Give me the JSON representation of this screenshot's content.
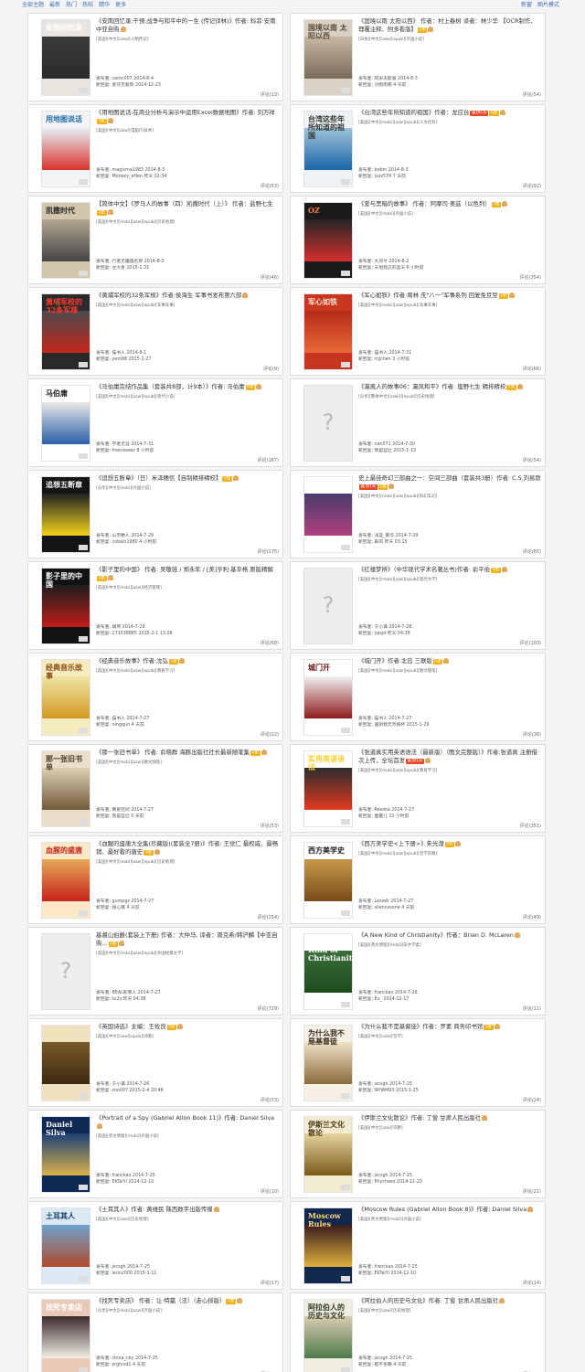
{
  "topbar": {
    "left": [
      "全部主题",
      "最新",
      "热门",
      "热帖",
      "精华",
      "更多"
    ],
    "right": [
      "新窗",
      "图片模式"
    ]
  },
  "posts": [
    {
      "title": "《安南回忆录:干预:战争与和平中的一生 (传记译林)》作者: 科菲·安南 中亚自购",
      "badges": [
        "thumb"
      ],
      "tags": "[美国][中文][azw][人物传记]",
      "poster": "发布者: caroc007 2014-8-4",
      "reply": "新回复: 墨仔无敌熊 2014-12-23",
      "comments": "评论(13)",
      "cover": {
        "bg": "#e9e6df",
        "mid": "#3a3a3a",
        "accent": "#2b2b2b",
        "text": "安南回忆录",
        "tc": "#ffffff"
      }
    },
    {
      "title": "《国境以南 太阳以西》 作者：村上春树 译者：林少华 【OCR制作、理覆注释、附多看版】",
      "badges": [
        "yellow:5星",
        "thumb"
      ],
      "tags": "[日本][中文][azw][epub][外国小说]",
      "poster": "发布者: 阿米夫斯基 2014-8-3",
      "reply": "新回复: 对街南嘟 4 天前",
      "comments": "评论(54)",
      "cover": {
        "bg": "#d8d1c4",
        "mid": "#c7b9a5",
        "accent": "#7a6a5a",
        "text": "国境以南 太阳以西",
        "tc": "#5b4c3d"
      }
    },
    {
      "title": "《用地图说话:在商业分析与演示中运用Excel数据地图》作者: 刘万祥",
      "badges": [
        "yellow:5星",
        "thumb"
      ],
      "tags": "[美国][中文][azw][电脑IT/技术]",
      "poster": "发布者: magicma1983 2014-8-3",
      "reply": "新回复: Monkey_eHen 昨天 02:34",
      "comments": "评论(63)",
      "cover": {
        "bg": "#f4f4f4",
        "mid": "#e7eef4",
        "accent": "#d9342b",
        "text": "用地图说话",
        "tc": "#1f6fb0"
      }
    },
    {
      "title": "《台湾这些年所知道的祖国》作者：龙应台",
      "badges": [
        "red:置顶1天",
        "yellow:5星",
        "thumb"
      ],
      "tags": "[美国][中文][mobi][azw][epub][人文社科]",
      "poster": "发布者: bobm 2014-8-3",
      "reply": "新回复: jxzx574 7 天前",
      "comments": "评论(92)",
      "cover": {
        "bg": "#eef2f4",
        "mid": "#9cc1d8",
        "accent": "#1b67a9",
        "text": "台湾这些年所知道的祖国",
        "tc": "#333333"
      }
    },
    {
      "title": "【简体中文】《罗马人的故事（四）凯撒时代（上）》 作者：盐野七生",
      "badges": [
        "yellow:5星",
        "thumb"
      ],
      "tags": "[美国][中文][mobi][azw][epub][历史地理]",
      "poster": "发布者: 行者无疆遇名即 2014-8-3",
      "reply": "新回复: 左大星 2015-1-31",
      "comments": "评论(46)",
      "pink": true,
      "cover": {
        "bg": "#d2c7ad",
        "mid": "#b3a78f",
        "accent": "#444444",
        "text": "凯撒时代",
        "tc": "#2c2c2c"
      }
    },
    {
      "title": "《爱与黑暗的故事》 作者：阿摩司·奥兹（以色列）",
      "badges": [
        "yellow:5星",
        "thumb"
      ],
      "tags": "[美国][中文][mobi][外国小说]",
      "poster": "发布者: 大风兮 2014-8-2",
      "reply": "新回复: 天地我辺的蓝天 6 小时前",
      "comments": "评论(354)",
      "cover": {
        "bg": "#1a1a1a",
        "mid": "#262626",
        "accent": "#d42e2e",
        "text": "OZ",
        "tc": "#ff7e4a"
      }
    },
    {
      "title": "《黄埔军校的32条军规》作者:侯海生 军事书发布第六部",
      "badges": [
        "thumb"
      ],
      "tags": "[美国][中文][mobi][azw][epub][军事军事]",
      "poster": "发布者: 猫书人 2014-8-1",
      "reply": "新回复: yem88 2015-1-27",
      "comments": "评论(9)",
      "cover": {
        "bg": "#2a2a2a",
        "mid": "#4a4a4a",
        "accent": "#c4261e",
        "text": "黄埔军校的32条军规",
        "tc": "#ff3b2e"
      }
    },
    {
      "title": "《军心如铁》作者:周林 庆\"八一\"军事系列 回复免豆豆",
      "badges": [
        "yellow:5星",
        "thumb"
      ],
      "tags": "[美国][中文][mobi][azw][epub][军事军事]",
      "poster": "发布者: 猫书人 2014-7-31",
      "reply": "新回复: rrjjchen 3 小时前",
      "comments": "评论(66)",
      "cover": {
        "bg": "#c8361f",
        "mid": "#b52a18",
        "accent": "#e86a3a",
        "text": "军心如铁",
        "tc": "#ffdfd0"
      }
    },
    {
      "title": "《马伯庸完结作品集（套装共8部，计9本）》作者: 马伯庸",
      "badges": [
        "yellow:5星",
        "thumb"
      ],
      "tags": "[美国][中文][mobi][azw][epub][现代小说]",
      "poster": "发布者: 学者无涯 2014-7-31",
      "reply": "新回复: freeviewer 8 小时前",
      "comments": "评论(167)",
      "cover": {
        "bg": "#ffffff",
        "mid": "#e8e8e8",
        "accent": "#2a5fa8",
        "text": "马伯庸",
        "tc": "#1f1f1f"
      }
    },
    {
      "title": "《瀛風人的故事06：瀛风和平》作者: 塩野七生 精排精校",
      "badges": [
        "yellow:5星",
        "thumb"
      ],
      "tags": "[分享][繁体中文][azw3][epub][历史地理]",
      "poster": "发布者: nan571 2014-7-30",
      "reply": "新回复: 我是蓝灶 2015-1-13",
      "comments": "评论(54)",
      "placeholder": true
    },
    {
      "title": "《追想五断章》（日）米泽穗信【自制精排精校】",
      "badges": [
        "yellow:5星",
        "thumb"
      ],
      "tags": "[分享][中文][mobi][外国小说]",
      "poster": "发布者: 山奈敷人 2014-7-29",
      "reply": "新回复: cobain1980 4 小时前",
      "comments": "评论(175)",
      "cover": {
        "bg": "#151515",
        "mid": "#222222",
        "accent": "#f2d21c",
        "text": "追想五断章",
        "tc": "#f2f2f2"
      }
    },
    {
      "title": "史上最佳奇幻三部曲之一：空间三部曲（套装共3册）作者: C.S.刘易斯",
      "badges": [
        "red:置顶1天",
        "yellow:5星",
        "thumb"
      ],
      "tags": "[美国][中文][mobi][azw][epub][科幻玄幻]",
      "poster": "发布者: 浅蓝_繁华 2014-7-29",
      "reply": "新回复: 辟凤 昨天 03:15",
      "comments": "评论(65)",
      "cover": {
        "bg": "#ffffff",
        "mid": "#4b3a6e",
        "accent": "#b0417a",
        "text": "空间三部曲",
        "tc": "#ffffff"
      }
    },
    {
      "title": "《影子里的中国》 作者: 吴敬琏 / 郑永年 / [美]亨利·基辛格 原版精解",
      "badges": [
        "yellow:5星",
        "thumb"
      ],
      "tags": "[美国][中文][mobi][azw][经济管理]",
      "poster": "发布者: 胡燕 2014-7-29",
      "reply": "新回复: 271538885 2015-2-1 13:06",
      "comments": "评论(68)",
      "cover": {
        "bg": "#121212",
        "mid": "#1d1d1d",
        "accent": "#c21d1d",
        "text": "影子里的中国",
        "tc": "#ffffff"
      }
    },
    {
      "title": "《红楼梦辨》（中华现代学术名著丛书)作者: 俞平伯",
      "badges": [
        "yellow:5星",
        "thumb"
      ],
      "tags": "[美国][中文][mobi][azw][epub][现代文学]",
      "poster": "发布者: 于小满 2014-7-28",
      "reply": "新回复: ypsjd 昨天 04:38",
      "comments": "评论(103)",
      "placeholder": true
    },
    {
      "title": "《经典音乐故事》作者:沈弘",
      "badges": [
        "yellow:5星",
        "thumb"
      ],
      "tags": "[美国][中文][mobi][azw][epub][教育学习]",
      "poster": "发布者: 猫书人 2014-7-27",
      "reply": "新回复: ningqun 4 天前",
      "comments": "评论(22)",
      "cover": {
        "bg": "#f4ecbf",
        "mid": "#efe3a5",
        "accent": "#d19a22",
        "text": "经典音乐故事",
        "tc": "#8a4a10"
      }
    },
    {
      "title": "《城门开》作者:北岛 三联版",
      "badges": [
        "yellow:5星",
        "thumb"
      ],
      "tags": "[美国][中文][mobi][azw][epub][散文随笔]",
      "poster": "发布者: 猫书人 2014-7-27",
      "reply": "新回复: 遇到我无奈摔杯 2015-1-29",
      "comments": "评论(36)",
      "cover": {
        "bg": "#ffffff",
        "mid": "#f0f0f0",
        "accent": "#8e1d1d",
        "text": "城门开",
        "tc": "#6e1414"
      }
    },
    {
      "title": "《那一张旧书单》 作者: 俞晓群 海豚出版社社长最新随笔集",
      "badges": [
        "yellow:5星",
        "thumb"
      ],
      "tags": "[美国][中文][mobi][azw][散文随笔]",
      "poster": "发布者: 黄葛空间 2014-7-27",
      "reply": "新回复: 我是蓝灶 5 天前",
      "comments": "评论(53)",
      "cover": {
        "bg": "#e9dfc8",
        "mid": "#ddd0b3",
        "accent": "#6f5a3a",
        "text": "那一张旧书单",
        "tc": "#4a3a26"
      }
    },
    {
      "title": "《张道真实用英语语法（最新版）（图文完整版）》作者:张道真 注册借次上传，全坛首发",
      "badges": [
        "red:置顶1天",
        "thumb"
      ],
      "tags": "[美国][中文][mobi][azw][epub][教育学习]",
      "poster": "发布者: Rexoka 2014-7-27",
      "reply": "新回复: 面蔓儿 11 小时前",
      "comments": "评论(351)",
      "cover": {
        "bg": "#ffffff",
        "mid": "#2c2c2c",
        "accent": "#e03a1e",
        "text": "实用英语语法",
        "tc": "#ffcf26"
      }
    },
    {
      "title": "《血腥的盛唐大全集(珍藏版)(套装全7册)》作者: 王觉仁 最权威、最畅销、最好看的唐史",
      "badges": [
        "yellow:5星",
        "thumb"
      ],
      "tags": "[美国][中文][mobi][azw][epub][历史地理]",
      "poster": "发布者: gumpgz 2014-7-27",
      "reply": "新回复: 接心鹰 4 天前",
      "comments": "评论(154)",
      "cover": {
        "bg": "#fbe8c6",
        "mid": "#e8a85a",
        "accent": "#c7241b",
        "text": "血腥的盛唐",
        "tc": "#c7241b"
      }
    },
    {
      "title": "《西方美学史<上下册>》朱光潜",
      "badges": [
        "yellow:5星",
        "thumb"
      ],
      "tags": "[美国][中文][mobi][azw][epub][哲学宗教]",
      "poster": "发布者: Leszek 2014-7-27",
      "reply": "新回复: silencesone 4 天前",
      "comments": "评论(49)",
      "cover": {
        "bg": "#ffffff",
        "mid": "#c79a4a",
        "accent": "#7a4a1a",
        "text": "西方美学史",
        "tc": "#222222"
      }
    },
    {
      "title": "基督山伯爵(套装上下册) 作者：大仲马, 译者：周克希/韩沪麟【中亚自购...",
      "badges": [
        "yellow:5星",
        "thumb"
      ],
      "tags": "[美国][中文][mobi][azw][epub][外国经典文学]",
      "poster": "发布者: BEAL斯莱人 2014-7-27",
      "reply": "新回复: tu2s 昨天 04:38",
      "comments": "评论(729)",
      "placeholder": true
    },
    {
      "title": "《A New Kind of Christianity》作者：Brian D. McLaren",
      "badges": [
        "thumb"
      ],
      "tags": "[美国][英文原版][mobi][非文学类]",
      "poster": "发布者: franckao 2014-7-26",
      "reply": "新回复: Eu_ 2014-12-17",
      "comments": "评论(11)",
      "cover": {
        "bg": "#ffffff",
        "mid": "#3a6f3a",
        "accent": "#1e4a1e",
        "text": "A New Kind of Christianity",
        "tc": "#ffffff"
      }
    },
    {
      "title": "《英国诗选》主编：王佐良",
      "badges": [
        "yellow:5星",
        "thumb"
      ],
      "tags": "[美国][中文][azw][epub][诗歌]",
      "poster": "发布者: 于小满 2014-7-26",
      "reply": "新回复: zoo007 2015-2-4 20:48",
      "comments": "评论(33)",
      "cover": {
        "bg": "#efe1c0",
        "mid": "#7a5a2a",
        "accent": "#3a2a12",
        "text": "英国诗选",
        "tc": "#f4e4b4"
      }
    },
    {
      "title": "《为什么我不是基督徒》作者：罗素 商务印书馆",
      "badges": [
        "yellow:5星",
        "thumb"
      ],
      "tags": "[美国][中文][azw][哲学]",
      "poster": "发布者: jscsgh 2014-7-25",
      "reply": "新回复: WHAM93 2015-1-25",
      "comments": "评论(24)",
      "cover": {
        "bg": "#f6efe3",
        "mid": "#efe2c8",
        "accent": "#8a6a3a",
        "text": "为什么我不是基督徒",
        "tc": "#3a2a1a"
      }
    },
    {
      "title": "《Portrait of a Spy (Gabriel Allon Book 11)》作者: Daniel Silva",
      "badges": [
        "thumb"
      ],
      "tags": "[美国][英文原版][mobi][外国小说]",
      "poster": "发布者: franckao 2014-7-25",
      "reply": "新回复: EKTaiYi 2014-12-10",
      "comments": "评论(10)",
      "cover": {
        "bg": "#0f2a52",
        "mid": "#1c3f75",
        "accent": "#d8b24a",
        "text": "Daniel Silva",
        "tc": "#ffffff"
      }
    },
    {
      "title": "《伊斯兰文化散论》作者: 丁俊 甘肃人民出版社",
      "badges": [
        "thumb"
      ],
      "tags": "[美国][中文][azw][宗教]",
      "poster": "发布者: jscsgh 2014-7-25",
      "reply": "新回复: Phycheez 2014-12-20",
      "comments": "评论(21)",
      "cover": {
        "bg": "#f3ead2",
        "mid": "#e5d49f",
        "accent": "#7a5a1a",
        "text": "伊斯兰文化散论",
        "tc": "#4a3a10"
      }
    },
    {
      "title": "《土耳其人》作者: 黄维民 陕西数字出版传媒",
      "badges": [
        "thumb"
      ],
      "tags": "[美国][中文][azw][历史地理]",
      "poster": "发布者: jscsgh 2014-7-25",
      "reply": "新回复: leon2000 2015-1-11",
      "comments": "评论(17)",
      "cover": {
        "bg": "#dbe9f4",
        "mid": "#6fa3cf",
        "accent": "#b04a2a",
        "text": "土耳其人",
        "tc": "#1a3a6a"
      }
    },
    {
      "title": "《Moscow Rules (Gabriel Allon Book 8)》作者: Daniel Silva",
      "badges": [
        "thumb"
      ],
      "tags": "[美国][英文原版][mobi][外国小说]",
      "poster": "发布者: franckao 2014-7-25",
      "reply": "新回复: EKTaiYi 2014-12-10",
      "comments": "评论(14)",
      "cover": {
        "bg": "#13284f",
        "mid": "#3a1e1e",
        "accent": "#e0b03a",
        "text": "Moscow Rules",
        "tc": "#ffd87a"
      }
    },
    {
      "title": "《找死专卖店》 作者：让·特赢（法）（走心排版）",
      "badges": [
        "yellow:5星",
        "thumb"
      ],
      "tags": "[分享][中文][mobi][azw][外国小说]",
      "poster": "发布者: china_cby 2014-7-25",
      "reply": "新回复: zrgtcvd1 4 天前",
      "comments": "评论(14)",
      "cover": {
        "bg": "#e9c9b8",
        "mid": "#3a2a2a",
        "accent": "#f2efe6",
        "text": "找死专卖店",
        "tc": "#ffffff"
      }
    },
    {
      "title": "《阿拉伯人的历史与文化》作者: 丁俊 甘肃人民出版社",
      "badges": [
        "thumb"
      ],
      "tags": "[美国][中文][azw][历史地理]",
      "poster": "发布者: jscsgh 2014-7-25",
      "reply": "新回复: 鲲不冬眠 4 天前",
      "comments": "评论(21)",
      "cover": {
        "bg": "#f1ece0",
        "mid": "#d9ccb0",
        "accent": "#4e7a4a",
        "text": "阿拉伯人的历史与文化",
        "tc": "#2a3a20"
      }
    }
  ]
}
